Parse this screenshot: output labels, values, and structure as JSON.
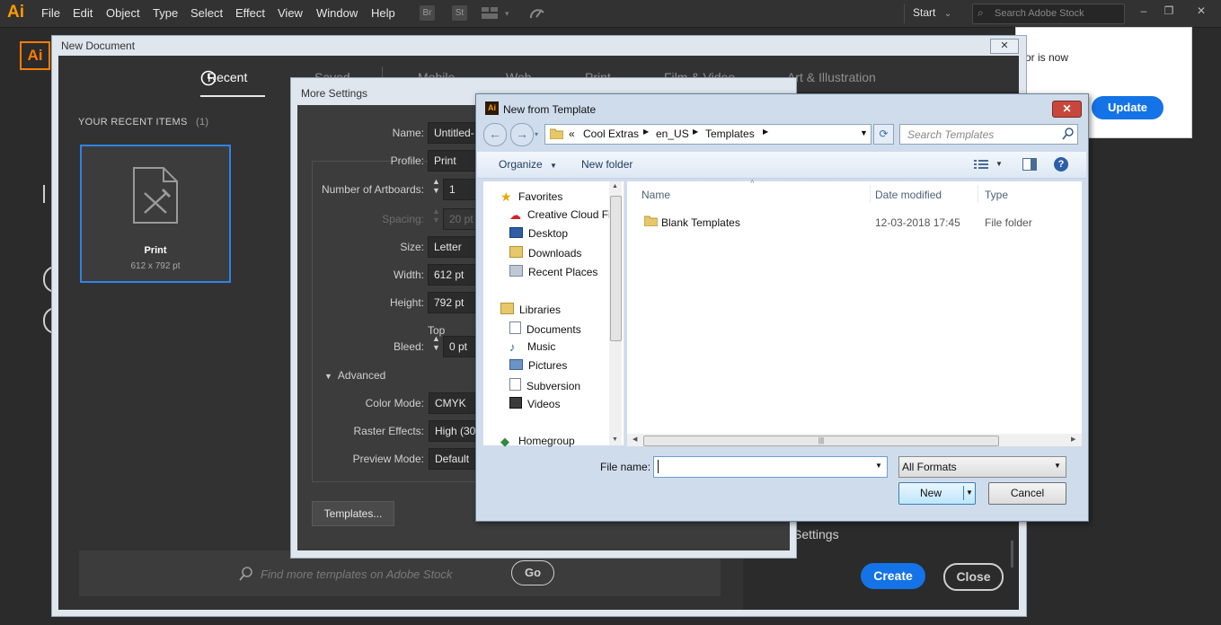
{
  "app": {
    "logo": "Ai",
    "menu": [
      "File",
      "Edit",
      "Object",
      "Type",
      "Select",
      "Effect",
      "View",
      "Window",
      "Help"
    ],
    "toolbar_badges": [
      "Br",
      "St"
    ],
    "workspace": "Start",
    "stock_search_placeholder": "Search Adobe Stock"
  },
  "update_notice": {
    "text": "or is now",
    "button": "Update"
  },
  "new_document": {
    "title": "New Document",
    "close_label": "✕",
    "tabs": [
      "Recent",
      "Saved",
      "Mobile",
      "Web",
      "Print",
      "Film & Video",
      "Art & Illustration"
    ],
    "recent_header": "YOUR RECENT ITEMS",
    "recent_count": "(1)",
    "recent_item": {
      "name": "Print",
      "size": "612 x 792 pt"
    },
    "stock_placeholder": "Find more templates on Adobe Stock",
    "go_label": "Go",
    "settings_label": "Settings",
    "create_label": "Create",
    "close_button": "Close"
  },
  "more_settings": {
    "title": "More Settings",
    "fields": {
      "name": {
        "label": "Name:",
        "value": "Untitled-"
      },
      "profile": {
        "label": "Profile:",
        "value": "Print"
      },
      "artboards": {
        "label": "Number of Artboards:",
        "value": "1"
      },
      "spacing": {
        "label": "Spacing:",
        "value": "20 pt"
      },
      "size": {
        "label": "Size:",
        "value": "Letter"
      },
      "width": {
        "label": "Width:",
        "value": "612 pt"
      },
      "height": {
        "label": "Height:",
        "value": "792 pt"
      },
      "bleed_top_label": "Top",
      "bleed": {
        "label": "Bleed:",
        "value": "0 pt"
      },
      "color_mode": {
        "label": "Color Mode:",
        "value": "CMYK"
      },
      "raster": {
        "label": "Raster Effects:",
        "value": "High (30"
      },
      "preview": {
        "label": "Preview Mode:",
        "value": "Default"
      }
    },
    "advanced_label": "Advanced",
    "templates_button": "Templates..."
  },
  "file_dialog": {
    "title": "New from Template",
    "breadcrumb": [
      "Cool Extras",
      "en_US",
      "Templates"
    ],
    "breadcrumb_prefix": "«",
    "search_placeholder": "Search Templates",
    "organize": "Organize",
    "new_folder": "New folder",
    "nav": {
      "favorites": "Favorites",
      "fav_items": [
        "Creative Cloud Fi",
        "Desktop",
        "Downloads",
        "Recent Places"
      ],
      "libraries": "Libraries",
      "lib_items": [
        "Documents",
        "Music",
        "Pictures",
        "Subversion",
        "Videos"
      ],
      "homegroup": "Homegroup"
    },
    "columns": {
      "name": "Name",
      "date": "Date modified",
      "type": "Type"
    },
    "rows": [
      {
        "name": "Blank Templates",
        "date": "12-03-2018 17:45",
        "type": "File folder"
      }
    ],
    "file_name_label": "File name:",
    "file_name_value": "",
    "format": "All Formats",
    "new_button": "New",
    "cancel_button": "Cancel"
  },
  "colors": {
    "accent_blue": "#1473e6",
    "ai_orange": "#ff7c00",
    "dark_bg": "#323232"
  }
}
